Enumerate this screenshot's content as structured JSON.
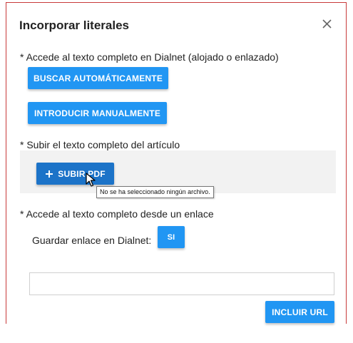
{
  "dialog": {
    "title": "Incorporar literales",
    "close_icon": "close-icon"
  },
  "dialnet_section": {
    "label": "* Accede al texto completo en Dialnet (alojado o enlazado)",
    "auto_search_button": "BUSCAR AUTOMÁTICAMENTE",
    "manual_button": "INTRODUCIR MANUALMENTE"
  },
  "upload_section": {
    "label": "* Subir el texto completo del artículo",
    "upload_button": "SUBIR PDF",
    "plus_icon": "plus-icon",
    "tooltip": "No se ha seleccionado ningún archivo."
  },
  "link_section": {
    "label": "* Accede al texto completo desde un enlace",
    "save_link_label": "Guardar enlace en Dialnet:",
    "save_link_toggle": "SI",
    "url_input_value": "",
    "include_url_button": "INCLUIR URL"
  },
  "colors": {
    "primary": "#2196f3",
    "primary_dark": "#1c73c8",
    "dialog_border": "#c83a3a",
    "upload_area_bg": "#f2f2f2"
  }
}
